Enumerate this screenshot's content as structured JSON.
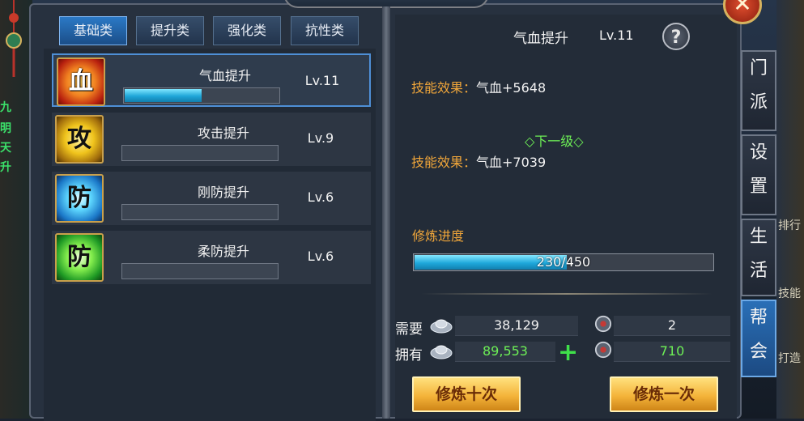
{
  "tabs": [
    {
      "label": "基础类"
    },
    {
      "label": "提升类"
    },
    {
      "label": "强化类"
    },
    {
      "label": "抗性类"
    }
  ],
  "skills": [
    {
      "name": "气血提升",
      "level": "Lv.11",
      "icon_char": "血",
      "icon_color": "#c8321a",
      "progress": 0.5
    },
    {
      "name": "攻击提升",
      "level": "Lv.9",
      "icon_char": "攻",
      "icon_color": "#e0b21c",
      "progress": 0
    },
    {
      "name": "刚防提升",
      "level": "Lv.6",
      "icon_char": "防",
      "icon_color": "#2a9ad8",
      "progress": 0
    },
    {
      "name": "柔防提升",
      "level": "Lv.6",
      "icon_char": "防",
      "icon_color": "#34b640",
      "progress": 0
    }
  ],
  "detail": {
    "title": "气血提升",
    "level": "Lv.11",
    "effect_label": "技能效果：",
    "effect_value": "气血+5648",
    "next_label": "◇下一级◇",
    "next_effect_label": "技能效果：",
    "next_effect_value": "气血+7039",
    "progress_label": "修炼进度",
    "progress_text": "230/450",
    "progress_current": 230,
    "progress_max": 450
  },
  "cost": {
    "need_label": "需要",
    "have_label": "拥有",
    "need_silver": "38,129",
    "need_item": "2",
    "have_silver": "89,553",
    "have_item": "710",
    "silver_icon": "silver-ingot-icon",
    "item_icon": "practice-token-icon"
  },
  "buttons": {
    "ten": "修炼十次",
    "one": "修炼一次"
  },
  "side_tabs": [
    {
      "label": "门派",
      "active": false
    },
    {
      "label": "设置",
      "active": false
    },
    {
      "label": "生活",
      "active": false
    },
    {
      "label": "帮会",
      "active": true
    }
  ],
  "edge_left": [
    "九",
    "明",
    "天",
    "升"
  ],
  "edge_right": [
    "排行",
    "技能",
    "打造"
  ]
}
